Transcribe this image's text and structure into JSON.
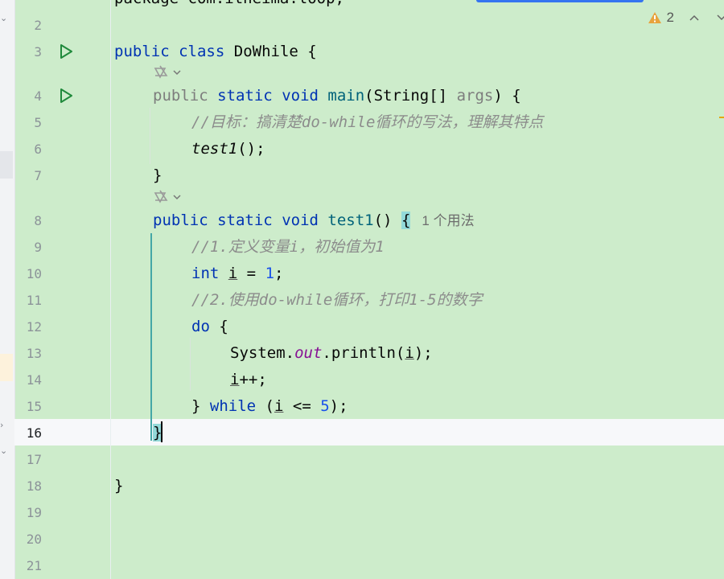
{
  "editor": {
    "inspection": {
      "warnings": "2"
    },
    "lines": [
      {
        "no": "2"
      },
      {
        "no": "3"
      },
      {
        "no": "4"
      },
      {
        "no": "5"
      },
      {
        "no": "6"
      },
      {
        "no": "7"
      },
      {
        "no": "8"
      },
      {
        "no": "9"
      },
      {
        "no": "10"
      },
      {
        "no": "11"
      },
      {
        "no": "12"
      },
      {
        "no": "13"
      },
      {
        "no": "14"
      },
      {
        "no": "15"
      },
      {
        "no": "16"
      },
      {
        "no": "17"
      },
      {
        "no": "18"
      },
      {
        "no": "19"
      },
      {
        "no": "20"
      },
      {
        "no": "21"
      }
    ],
    "code": {
      "line1_partial": "package com.itheima.loop;",
      "class_decl": {
        "kw1": "public",
        "kw2": "class",
        "name": "DoWhile",
        "brace": " {"
      },
      "main_decl": {
        "kw1": "public",
        "kw2": "static",
        "kw3": "void",
        "name": "main",
        "open": "(String[] ",
        "param": "args",
        "close": ") {"
      },
      "comment1": "//目标：搞清楚do-while循环的写法，理解其特点",
      "call_test1": "test1",
      "call_test1_rest": "();",
      "close_main": "}",
      "test1_decl": {
        "kw1": "public",
        "kw2": "static",
        "kw3": "void",
        "name": "test1",
        "parens": "() ",
        "brace": "{",
        "usages": "1 个用法"
      },
      "comment2": "//1.定义变量i，初始值为1",
      "int_decl": {
        "kw": "int",
        "var": "i",
        "eq": " = ",
        "num": "1",
        "semi": ";"
      },
      "comment3": "//2.使用do-while循环，打印1-5的数字",
      "do_kw": "do",
      "do_brace": " {",
      "println": {
        "cls": "System.",
        "field": "out",
        "call": ".println(",
        "var": "i",
        "end": ");"
      },
      "incr": {
        "var": "i",
        "rest": "++;"
      },
      "while_line": {
        "close": "} ",
        "kw": "while",
        "open": " (",
        "var": "i",
        "op": " <= ",
        "num": "5",
        "end": ");"
      },
      "close_test1": "}",
      "close_class": "}"
    }
  }
}
